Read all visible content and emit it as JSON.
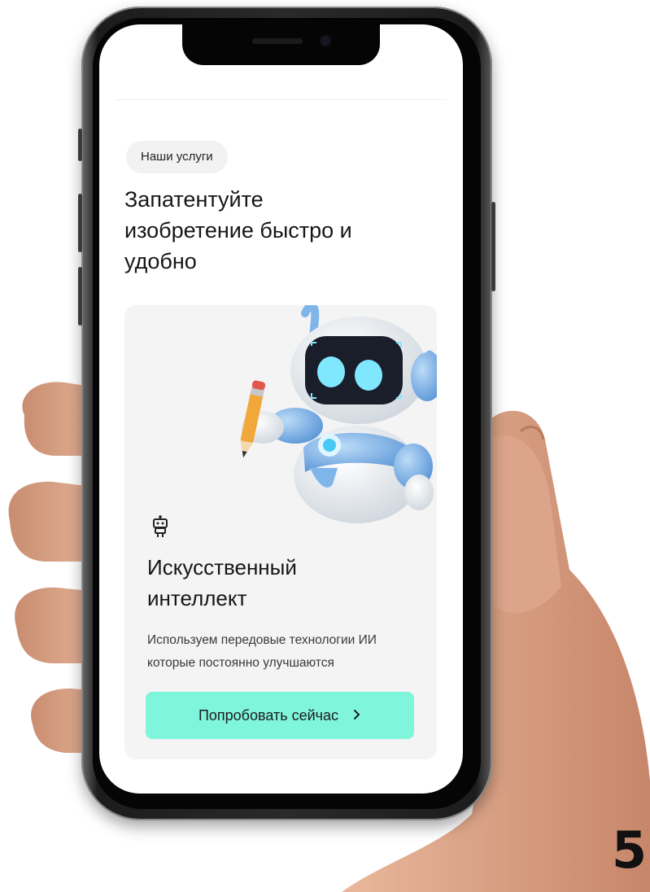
{
  "services_chip": "Наши услуги",
  "headline": "Запатентуйте изобретение быстро и удобно",
  "card": {
    "title": "Искусственный интеллект",
    "description": "Используем передовые технологии ИИ которые постоянно улучшаются",
    "button_label": "Попробовать сейчас",
    "button_icon": "chevron-right-icon",
    "card_icon": "robot-icon"
  },
  "page_number": "5",
  "colors": {
    "accent": "#7ff5dc",
    "card_background": "#f4f4f4",
    "chip_background": "#f2f2f2",
    "robot_blue": "#7fb6ea"
  }
}
